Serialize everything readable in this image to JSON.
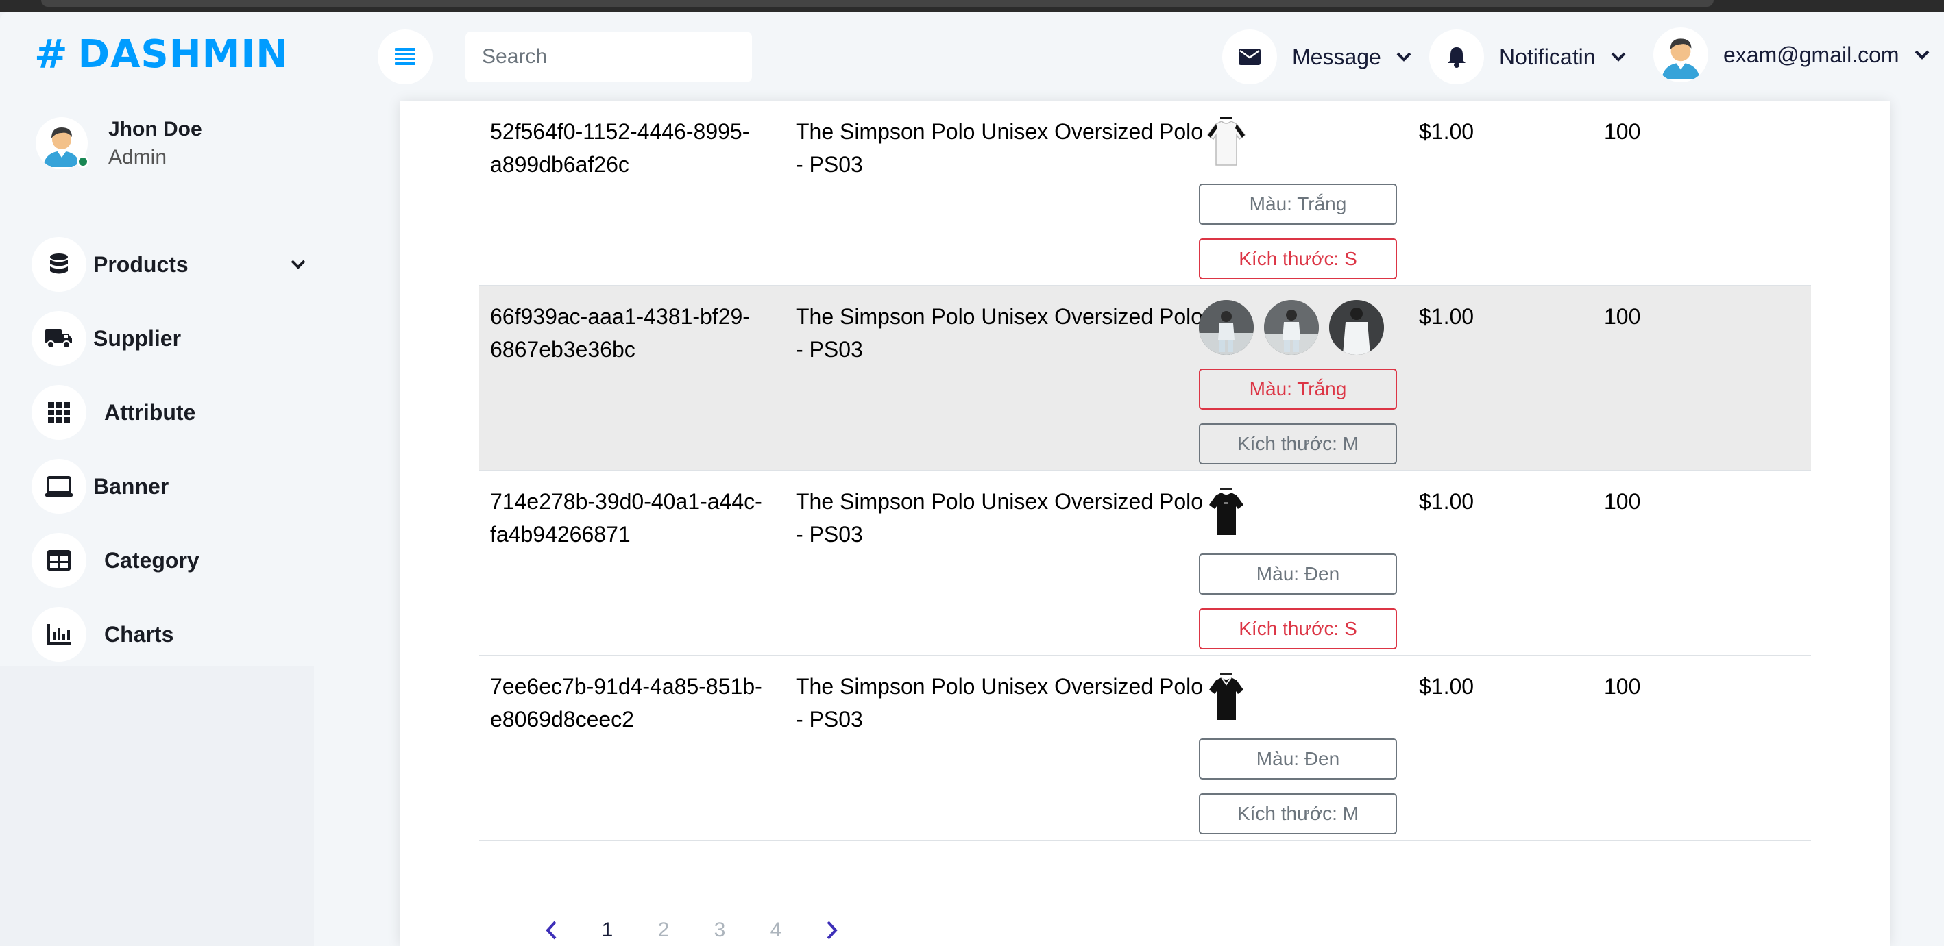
{
  "brand": {
    "hash": "#",
    "name": "DASHMIN"
  },
  "profile": {
    "name": "Jhon Doe",
    "role": "Admin"
  },
  "sidebar": {
    "items": [
      {
        "label": "Products",
        "icon": "database-icon",
        "has_chevron": true
      },
      {
        "label": "Supplier",
        "icon": "truck-icon"
      },
      {
        "label": "Attribute",
        "icon": "grid-icon"
      },
      {
        "label": "Banner",
        "icon": "laptop-icon"
      },
      {
        "label": "Category",
        "icon": "table-icon"
      },
      {
        "label": "Charts",
        "icon": "bar-chart-icon"
      }
    ]
  },
  "header": {
    "search_placeholder": "Search",
    "message_label": "Message",
    "notification_label": "Notificatin",
    "user_email": "exam@gmail.com"
  },
  "table": {
    "rows": [
      {
        "id": "52f564f0-1152-4446-8995-a899db6af26c",
        "name": "The Simpson Polo Unisex Oversized Polo - PS03",
        "images": [
          "white-polo"
        ],
        "color_label": "Màu: Trắng",
        "size_label": "Kích thước: S",
        "price": "$1.00",
        "qty": "100",
        "highlight": false
      },
      {
        "id": "66f939ac-aaa1-4381-bf29-6867eb3e36bc",
        "name": "The Simpson Polo Unisex Oversized Polo - PS03",
        "images": [
          "photo",
          "photo",
          "photo"
        ],
        "color_label": "Màu: Trắng",
        "size_label": "Kích thước: M",
        "price": "$1.00",
        "qty": "100",
        "highlight": true
      },
      {
        "id": "714e278b-39d0-40a1-a44c-fa4b94266871",
        "name": "The Simpson Polo Unisex Oversized Polo - PS03",
        "images": [
          "black-polo"
        ],
        "color_label": "Màu: Đen",
        "size_label": "Kích thước: S",
        "price": "$1.00",
        "qty": "100",
        "highlight": false
      },
      {
        "id": "7ee6ec7b-91d4-4a85-851b-e8069d8ceec2",
        "name": "The Simpson Polo Unisex Oversized Polo - PS03",
        "images": [
          "black-polo"
        ],
        "color_label": "Màu: Đen",
        "size_label": "Kích thước: M",
        "price": "$1.00",
        "qty": "100",
        "highlight": false
      }
    ]
  },
  "pagination": {
    "prev": "‹",
    "pages": [
      "1",
      "2",
      "3",
      "4"
    ],
    "current": "1",
    "next": "›"
  },
  "colors": {
    "accent": "#009cff",
    "danger": "#dc3545",
    "secondary": "#6c757d",
    "online": "#198754"
  }
}
